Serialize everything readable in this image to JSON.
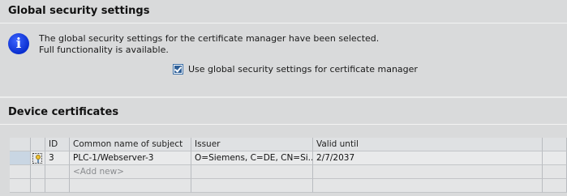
{
  "global": {
    "title": "Global security settings",
    "info_line1": "The global security settings for the certificate manager have been selected.",
    "info_line2": "Full functionality is available.",
    "info_icon_glyph": "i",
    "checkbox_label": "Use global security settings for certificate manager",
    "checkbox_checked": true
  },
  "devices": {
    "title": "Device certificates",
    "columns": [
      "",
      "",
      "ID",
      "Common name of subject",
      "Issuer",
      "Valid until",
      ""
    ],
    "rows": [
      {
        "id": "3",
        "subject": "PLC-1/Webserver-3",
        "issuer": "O=Siemens, C=DE, CN=Si...",
        "valid_until": "2/7/2037"
      }
    ],
    "add_new": "<Add new>"
  }
}
